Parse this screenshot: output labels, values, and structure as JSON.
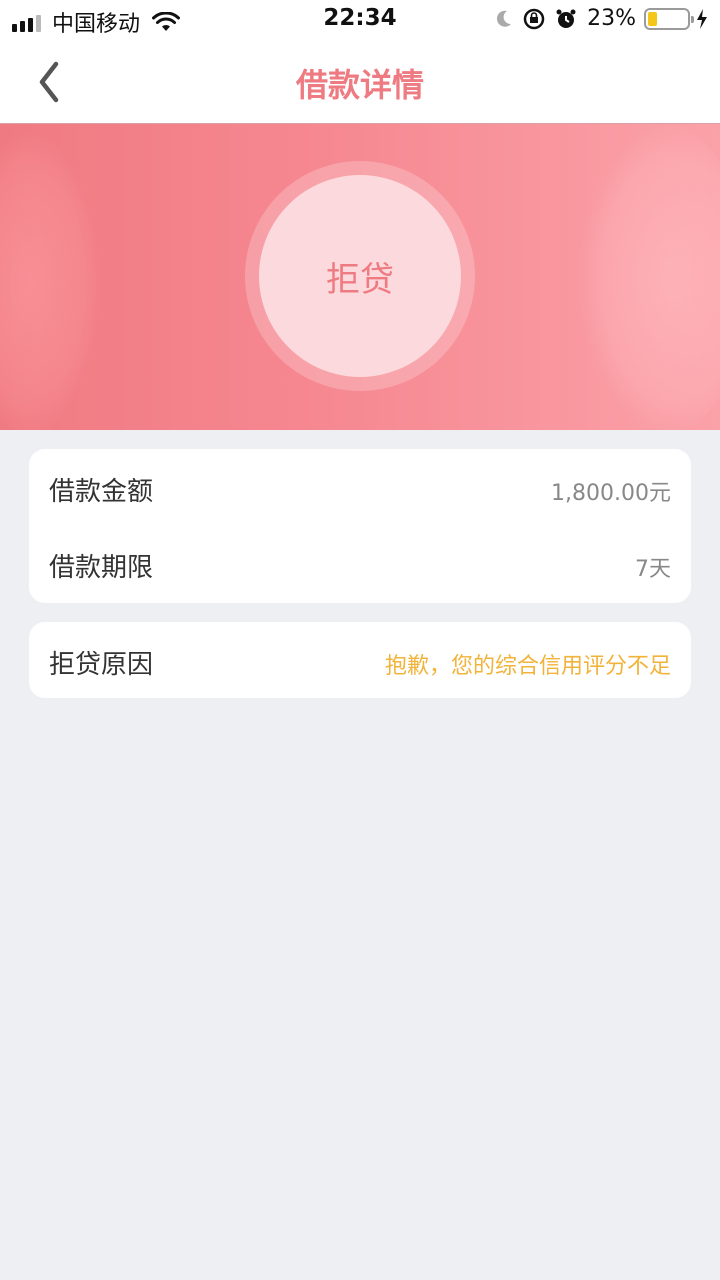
{
  "status_bar": {
    "carrier": "中国移动",
    "time": "22:34",
    "battery_percent": "23%",
    "battery_level": 0.23
  },
  "nav": {
    "title": "借款详情"
  },
  "hero": {
    "status_text": "拒贷"
  },
  "loan_info": {
    "amount_label": "借款金额",
    "amount_value": "1,800.00元",
    "term_label": "借款期限",
    "term_value": "7天"
  },
  "reject": {
    "reason_label": "拒贷原因",
    "reason_value": "抱歉，您的综合信用评分不足"
  },
  "colors": {
    "accent": "#ee7b82",
    "warning": "#f2b33a",
    "background": "#eeeff3"
  }
}
